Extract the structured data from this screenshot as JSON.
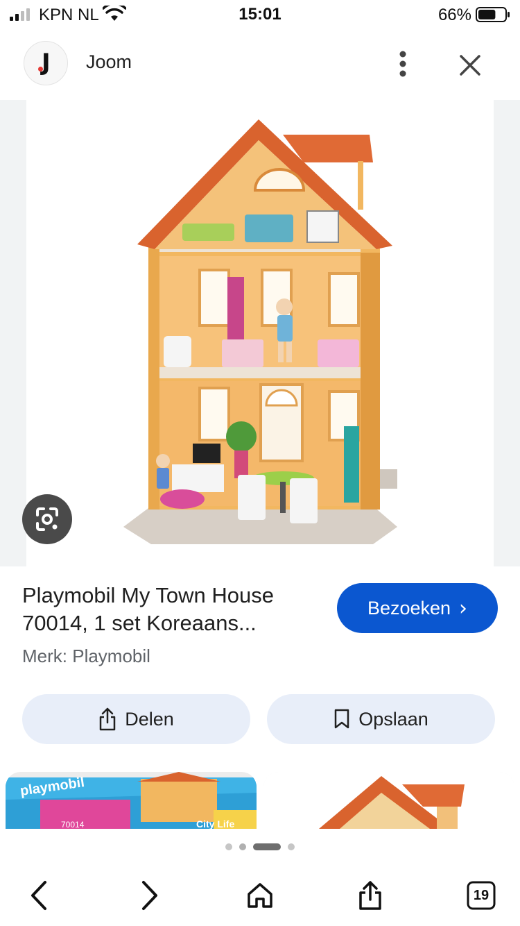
{
  "status": {
    "carrier": "KPN NL",
    "time": "15:01",
    "battery_percent": "66%",
    "battery_level": 0.66
  },
  "header": {
    "site_name": "Joom",
    "logo_letter": "J",
    "more_icon": "more-vert-icon",
    "close_icon": "close-icon"
  },
  "result": {
    "title": "Playmobil My Town House 70014, 1 set Koreaans...",
    "brand": "Merk: Playmobil",
    "visit_label": "Bezoeken",
    "share_label": "Delen",
    "save_label": "Opslaan"
  },
  "related": {
    "thumb1_brand": "playmobil",
    "thumb1_code": "70014",
    "thumb1_line": "City Life"
  },
  "pager": {
    "count": 4,
    "active_index": 2
  },
  "toolbar": {
    "tabs_count": "19",
    "icons": [
      "back-icon",
      "forward-icon",
      "home-icon",
      "share-icon",
      "tabs-icon"
    ]
  },
  "colors": {
    "accent": "#0b57d0",
    "tonal": "#e8eef9",
    "logo_dot": "#e53935"
  }
}
